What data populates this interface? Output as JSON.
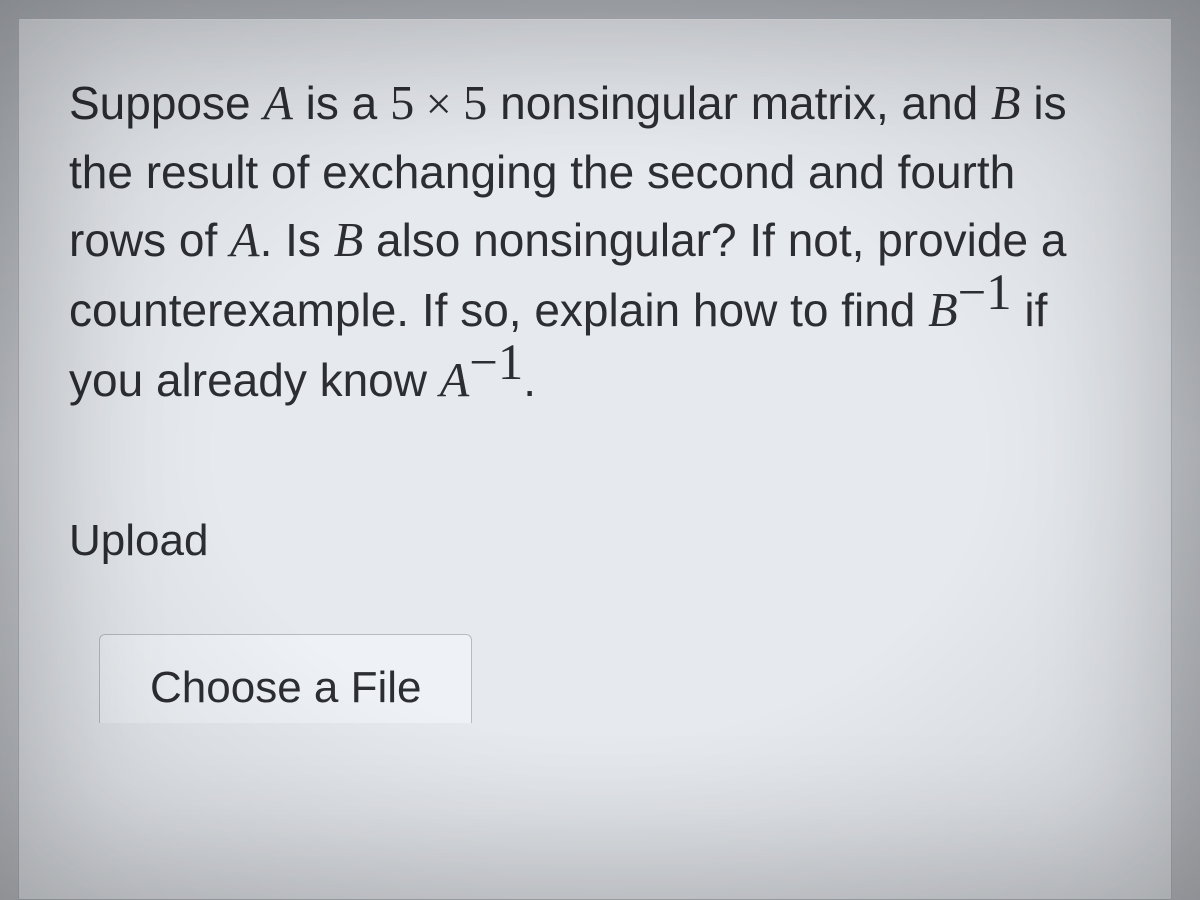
{
  "question": {
    "line1_pre": "Suppose ",
    "line1_A": "A",
    "line1_mid": " is a ",
    "line1_dim1": "5",
    "line1_times": " × ",
    "line1_dim2": "5",
    "line1_post": " nonsingular matrix, and ",
    "line2_B": "B",
    "line2_post": " is the result of exchanging the second and fourth rows of ",
    "line2_A": "A",
    "line2_period": ".  Is ",
    "line2_B2": "B",
    "line2_end": " also nonsingular?  If not, provide a counterexample.  If so, explain how to find ",
    "line3_B": "B",
    "line3_exp1": "−1",
    "line3_mid": " if you already know ",
    "line3_A": "A",
    "line3_exp2": "−1",
    "line3_end": "."
  },
  "upload": {
    "label": "Upload",
    "button": "Choose a File"
  }
}
